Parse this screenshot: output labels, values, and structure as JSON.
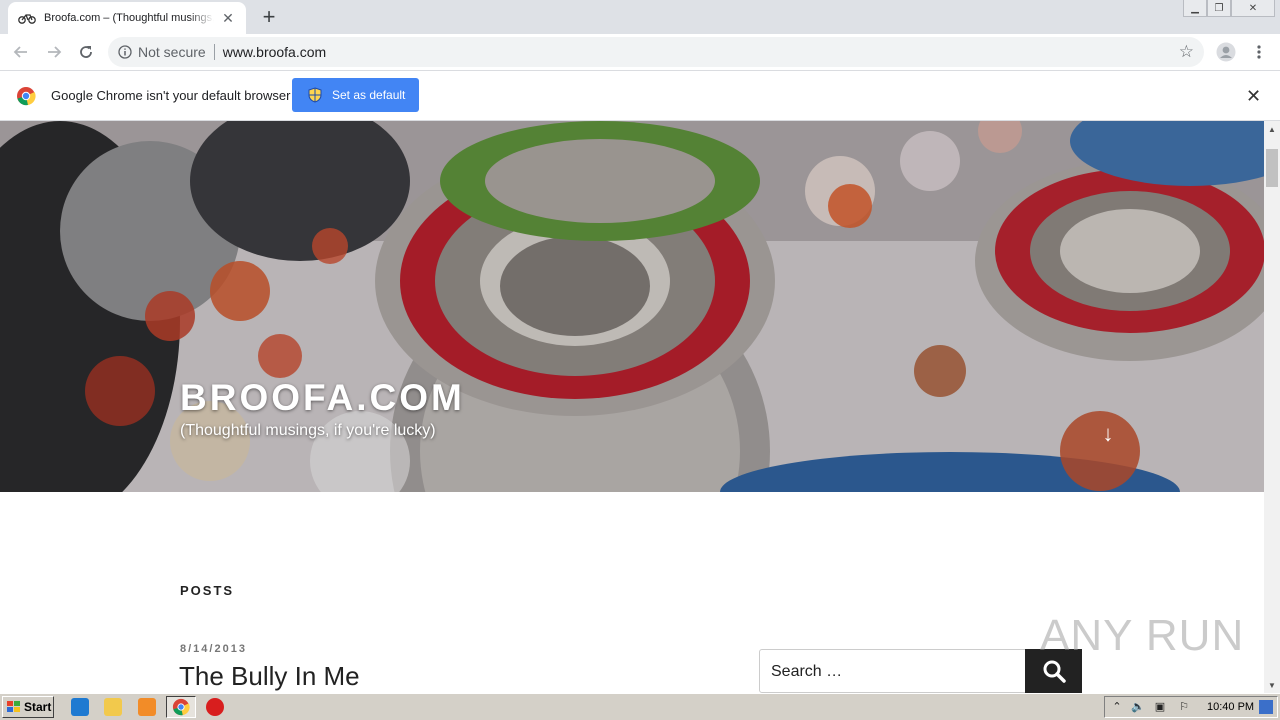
{
  "browser": {
    "tab_title": "Broofa.com – (Thoughtful musings, if you're lucky)",
    "tab_close": "✕",
    "new_tab": "+",
    "security_label": "Not secure",
    "url": "www.broofa.com"
  },
  "infobar": {
    "message": "Google Chrome isn't your default browser",
    "set_default_label": "Set as default",
    "close": "✕"
  },
  "site": {
    "title": "BROOFA.COM",
    "tagline": "(Thoughtful musings, if you're lucky)",
    "scroll_arrow": "↓"
  },
  "main": {
    "posts_heading": "POSTS",
    "post_date": "8/14/2013",
    "post_title": "The Bully In Me",
    "search_placeholder": "Search …"
  },
  "watermark": "ANY RUN",
  "taskbar": {
    "start_label": "Start",
    "clock": "10:40 PM"
  },
  "colors": {
    "infobar_button": "#4285f4",
    "search_button": "#222222",
    "tab_strip": "#dee1e6",
    "taskbar": "#d4d0c8"
  }
}
